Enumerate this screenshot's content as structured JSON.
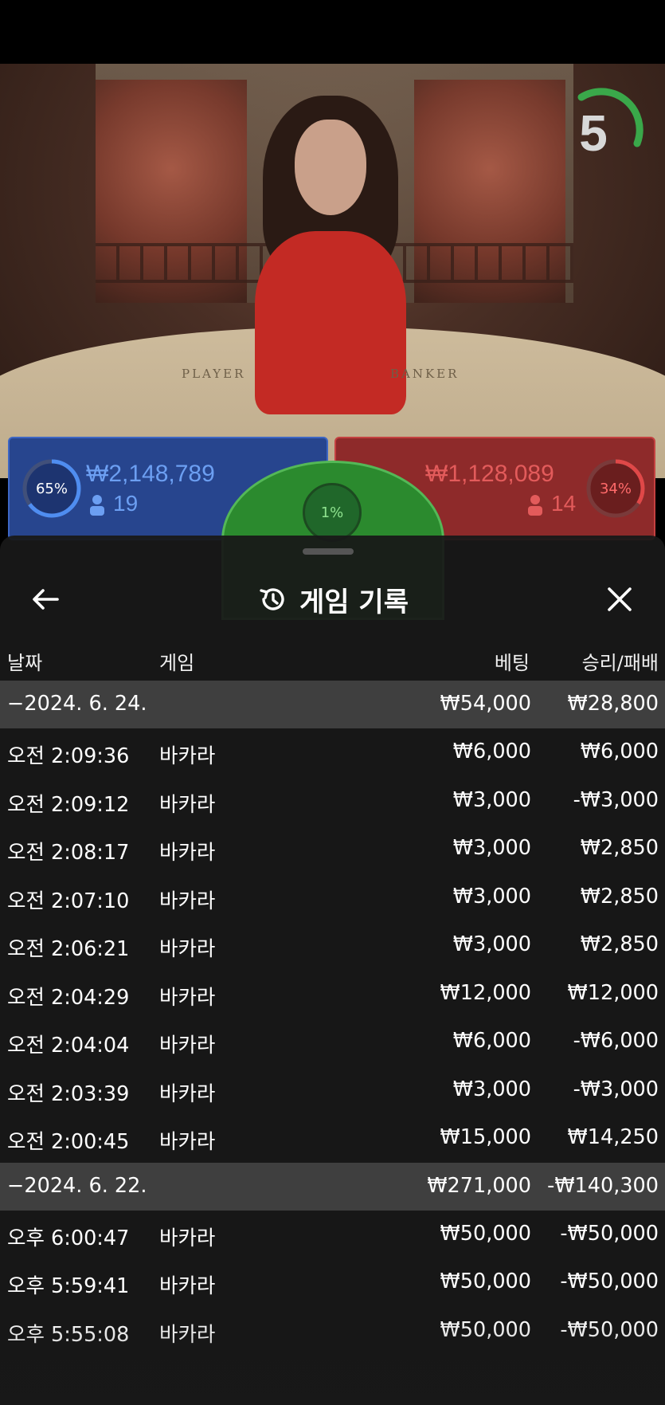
{
  "video": {
    "table_player_label": "PLAYER",
    "table_banker_label": "BANKER",
    "countdown": "5",
    "countdown_color": "#3aa84a"
  },
  "bets": {
    "player": {
      "pct": "65%",
      "amount": "₩2,148,789",
      "count": "19",
      "color": "#27458e"
    },
    "tie": {
      "pct": "1%",
      "color": "#2b8a2e"
    },
    "banker": {
      "pct": "34%",
      "amount": "₩1,128,089",
      "count": "14",
      "color": "#8e2a2a"
    }
  },
  "sheet": {
    "title": "게임 기록",
    "icons": {
      "back": "arrow-left-icon",
      "history": "history-icon",
      "close": "close-icon"
    },
    "columns": {
      "date": "날짜",
      "game": "게임",
      "bet": "베팅",
      "result": "승리/패배"
    },
    "groups": [
      {
        "date": "−2024. 6. 24.",
        "bet_total": "₩54,000",
        "result_total": "₩28,800",
        "rows": [
          {
            "time": "오전 2:09:36",
            "game": "바카라",
            "bet": "₩6,000",
            "result": "₩6,000"
          },
          {
            "time": "오전 2:09:12",
            "game": "바카라",
            "bet": "₩3,000",
            "result": "-₩3,000"
          },
          {
            "time": "오전 2:08:17",
            "game": "바카라",
            "bet": "₩3,000",
            "result": "₩2,850"
          },
          {
            "time": "오전 2:07:10",
            "game": "바카라",
            "bet": "₩3,000",
            "result": "₩2,850"
          },
          {
            "time": "오전 2:06:21",
            "game": "바카라",
            "bet": "₩3,000",
            "result": "₩2,850"
          },
          {
            "time": "오전 2:04:29",
            "game": "바카라",
            "bet": "₩12,000",
            "result": "₩12,000"
          },
          {
            "time": "오전 2:04:04",
            "game": "바카라",
            "bet": "₩6,000",
            "result": "-₩6,000"
          },
          {
            "time": "오전 2:03:39",
            "game": "바카라",
            "bet": "₩3,000",
            "result": "-₩3,000"
          },
          {
            "time": "오전 2:00:45",
            "game": "바카라",
            "bet": "₩15,000",
            "result": "₩14,250"
          }
        ]
      },
      {
        "date": "−2024. 6. 22.",
        "bet_total": "₩271,000",
        "result_total": "-₩140,300",
        "rows": [
          {
            "time": "오후 6:00:47",
            "game": "바카라",
            "bet": "₩50,000",
            "result": "-₩50,000"
          },
          {
            "time": "오후 5:59:41",
            "game": "바카라",
            "bet": "₩50,000",
            "result": "-₩50,000"
          },
          {
            "time": "오후 5:55:08",
            "game": "바카라",
            "bet": "₩50,000",
            "result": "-₩50,000"
          }
        ]
      }
    ]
  }
}
